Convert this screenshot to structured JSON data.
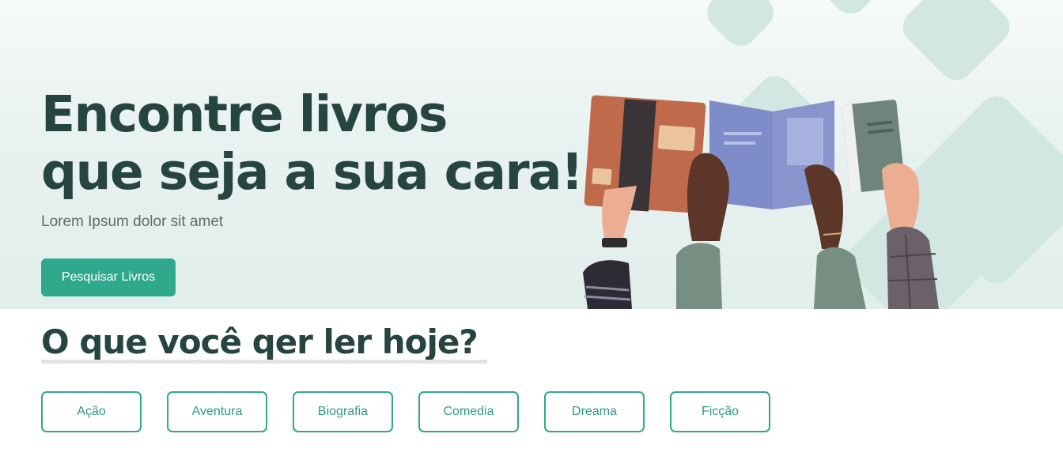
{
  "hero": {
    "title_line1": "Encontre livros",
    "title_line2": "que seja a sua cara!",
    "subtitle": "Lorem Ipsum dolor sit amet",
    "cta_label": "Pesquisar Livros"
  },
  "section": {
    "title": "O que você qer ler hoje?"
  },
  "genres": [
    "Ação",
    "Aventura",
    "Biografia",
    "Comedia",
    "Dreama",
    "Ficção"
  ],
  "colors": {
    "accent": "#2fa88c",
    "heading": "#264440",
    "hero_bg": "#e1eeec"
  }
}
